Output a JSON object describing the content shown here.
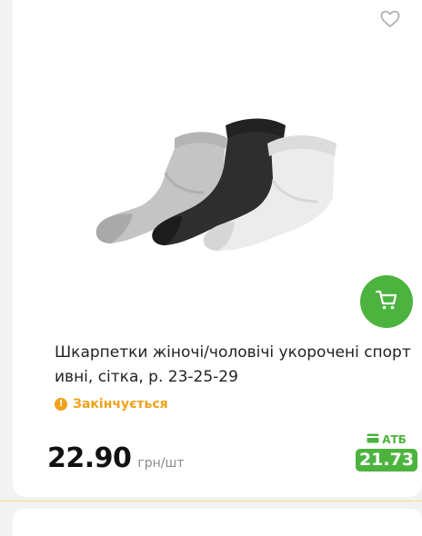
{
  "product": {
    "title": "Шкарпетки жіночі/чоловічі укорочені спорт ивні, сітка, р. 23-25-29",
    "status": "Закінчується",
    "status_icon": "exclamation-icon",
    "price": "22.90",
    "price_unit": "грн/шт",
    "club_label": "АТБ",
    "club_price": "21.73"
  },
  "colors": {
    "accent_green": "#4cb43e",
    "warning_orange": "#f0a21b"
  },
  "icons": {
    "favorite": "heart-icon",
    "cart": "cart-icon",
    "club": "card-icon"
  }
}
